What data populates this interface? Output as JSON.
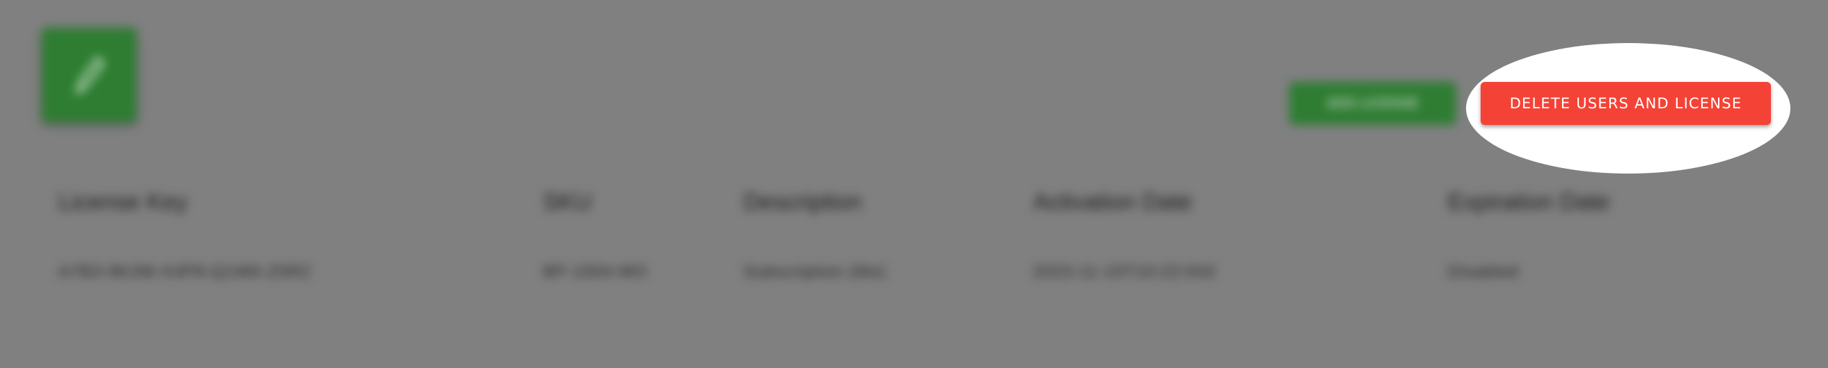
{
  "logo": {
    "icon": "edit-pencil-icon",
    "color": "#2e7d32"
  },
  "toolbar": {
    "add_label": "ADD LICENSE",
    "delete_label": "DELETE USERS AND LICENSE",
    "delete_color": "#f44336"
  },
  "table": {
    "columns": [
      "License Key",
      "SKU",
      "Description",
      "Activation Date",
      "Expiration Date"
    ],
    "rows": [
      [
        "A7B3-9K2M-X4P8-Q1W6-Z5R2",
        "BP-1004-MO",
        "Subscription (Mo)",
        "2023-11-15T10:22:04Z",
        "Disabled"
      ]
    ]
  },
  "overlay": {
    "backdrop_color": "#808080",
    "spotlight_color": "#ffffff"
  }
}
